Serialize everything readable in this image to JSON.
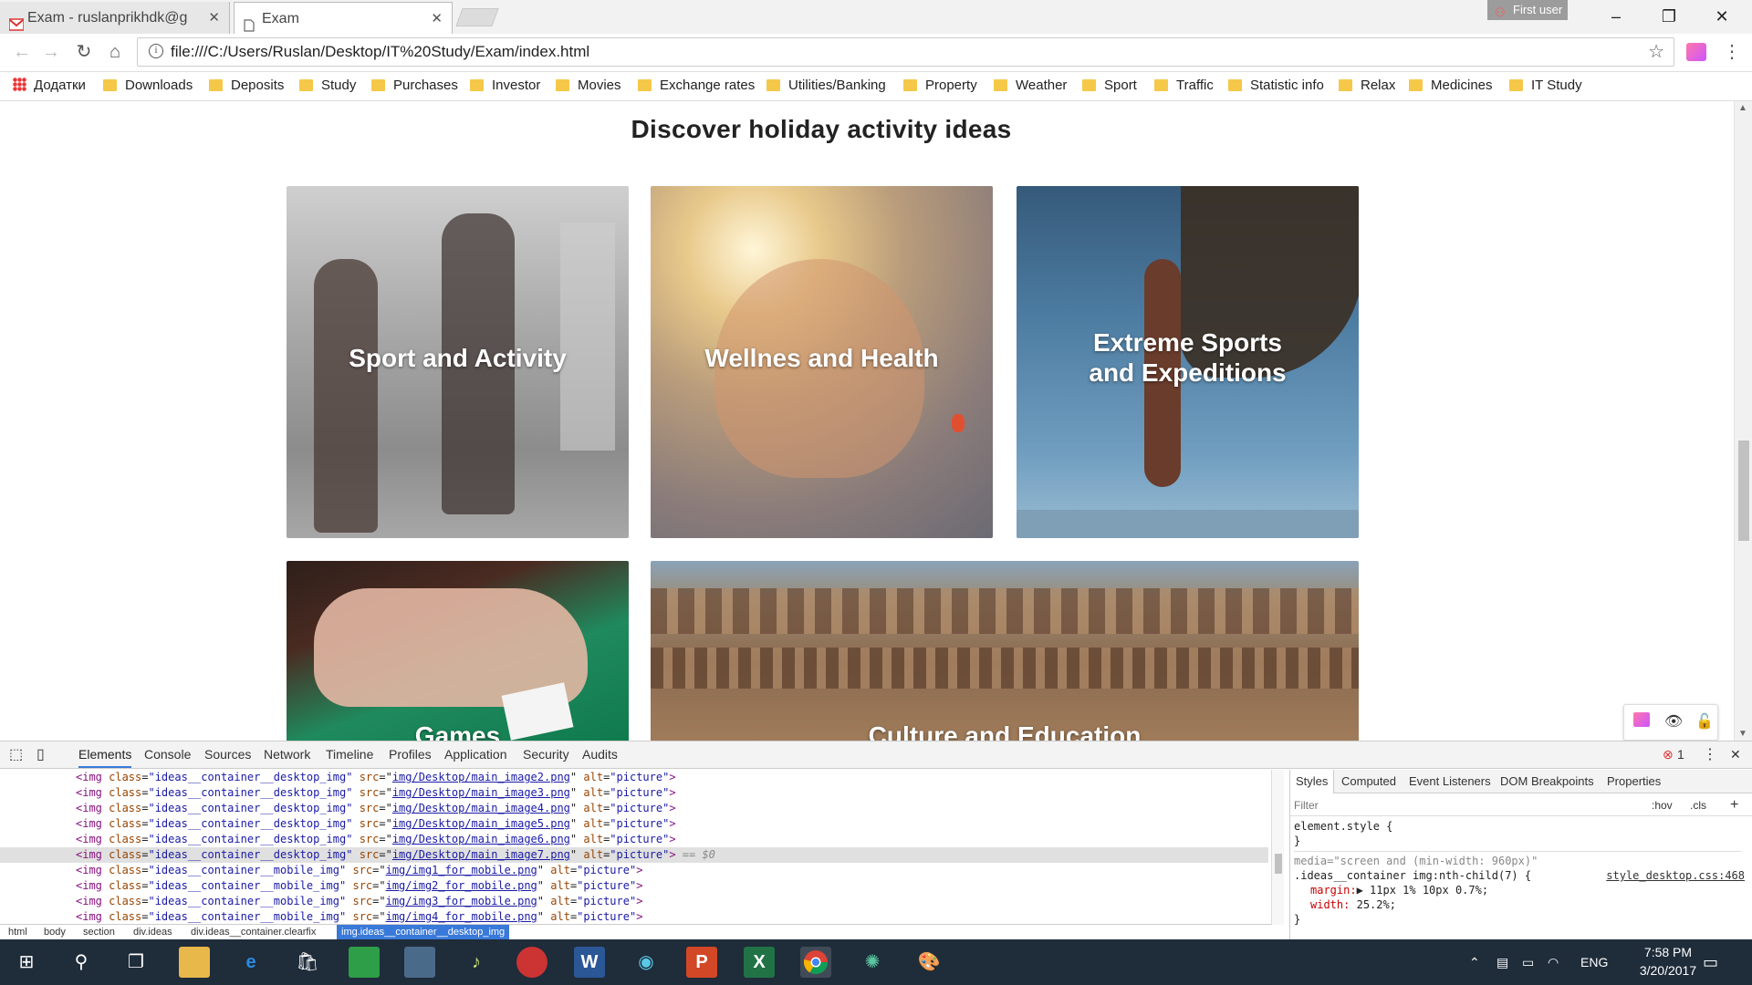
{
  "browser": {
    "tabs": [
      {
        "label": "Exam - ruslanprikhdk@g",
        "icon": "gmail-icon"
      },
      {
        "label": "Exam",
        "icon": "page-icon"
      }
    ],
    "user_badge": "First user",
    "address": "file:///C:/Users/Ruslan/Desktop/IT%20Study/Exam/index.html",
    "bookmarks": [
      "Додатки",
      "Downloads",
      "Deposits",
      "Study",
      "Purchases",
      "Investor",
      "Movies",
      "Exchange rates",
      "Utilities/Banking",
      "Property",
      "Weather",
      "Sport",
      "Traffic",
      "Statistic info",
      "Relax",
      "Medicines",
      "IT Study"
    ]
  },
  "page": {
    "heading": "Discover holiday activity ideas",
    "cards": [
      {
        "label": "Sport and Activity"
      },
      {
        "label": "Wellnes and Health"
      },
      {
        "label_line1": "Extreme Sports",
        "label_line2": "and Expeditions"
      },
      {
        "label": "Games"
      },
      {
        "label": "Culture and Education"
      }
    ]
  },
  "devtools": {
    "tabs": [
      "Elements",
      "Console",
      "Sources",
      "Network",
      "Timeline",
      "Profiles",
      "Application",
      "Security",
      "Audits"
    ],
    "error_count": "1",
    "code_lines": [
      {
        "cls": "ideas__container__desktop_img",
        "src": "img/Desktop/main_image2.png",
        "alt": "picture"
      },
      {
        "cls": "ideas__container__desktop_img",
        "src": "img/Desktop/main_image3.png",
        "alt": "picture"
      },
      {
        "cls": "ideas__container__desktop_img",
        "src": "img/Desktop/main_image4.png",
        "alt": "picture"
      },
      {
        "cls": "ideas__container__desktop_img",
        "src": "img/Desktop/main_image5.png",
        "alt": "picture"
      },
      {
        "cls": "ideas__container__desktop_img",
        "src": "img/Desktop/main_image6.png",
        "alt": "picture"
      },
      {
        "cls": "ideas__container__desktop_img",
        "src": "img/Desktop/main_image7.png",
        "alt": "picture",
        "suffix": "== $0"
      },
      {
        "cls": "ideas__container__mobile_img",
        "src": "img/img1_for_mobile.png",
        "alt": "picture"
      },
      {
        "cls": "ideas__container__mobile_img",
        "src": "img/img2_for_mobile.png",
        "alt": "picture"
      },
      {
        "cls": "ideas__container__mobile_img",
        "src": "img/img3_for_mobile.png",
        "alt": "picture"
      },
      {
        "cls": "ideas__container__mobile_img",
        "src": "img/img4_for_mobile.png",
        "alt": "picture"
      }
    ],
    "breadcrumbs": [
      "html",
      "body",
      "section",
      "div.ideas",
      "div.ideas__container.clearfix",
      "img.ideas__container__desktop_img"
    ],
    "side_tabs": [
      "Styles",
      "Computed",
      "Event Listeners",
      "DOM Breakpoints",
      "Properties"
    ],
    "filter_placeholder": "Filter",
    "hov": ":hov",
    "cls": ".cls",
    "styles": {
      "element_style": "element.style {",
      "close": "}",
      "media": "media=\"screen and (min-width: 960px)\"",
      "selector": ".ideas__container img:nth-child(7) {",
      "source": "style_desktop.css:468",
      "margin_prop": "margin:",
      "margin_val": "▶ 11px 1% 10px 0.7%;",
      "width_prop": "width:",
      "width_val": "25.2%;"
    }
  },
  "taskbar": {
    "lang": "ENG",
    "time": "7:58 PM",
    "date": "3/20/2017"
  },
  "colors": {
    "accent": "#3879d9",
    "taskbar": "#1f2c3a"
  }
}
